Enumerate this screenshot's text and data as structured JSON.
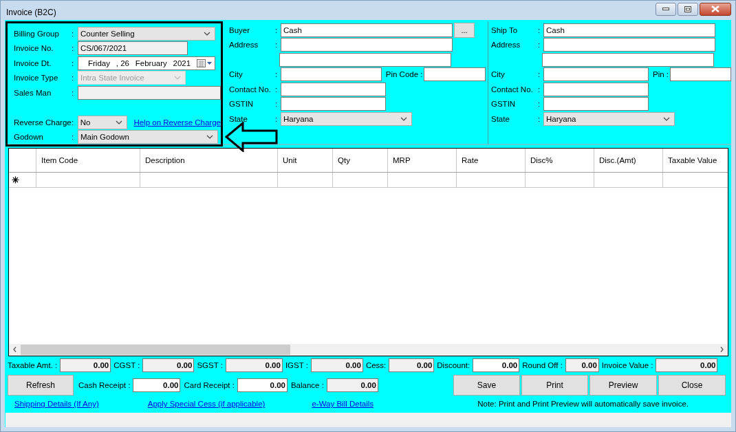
{
  "window": {
    "title": "Invoice (B2C)"
  },
  "invoice_panel": {
    "rows": [
      {
        "kind": "dropdown",
        "label": "Billing Group",
        "colon": ":",
        "value": "Counter Selling",
        "disabled": false
      },
      {
        "kind": "readonly",
        "label": "Invoice No.",
        "colon": ":",
        "value": "CS/067/2021"
      },
      {
        "kind": "date",
        "label": "Invoice Dt.",
        "colon": ":",
        "parts": [
          "Friday",
          ", 26",
          "February",
          "2021"
        ]
      },
      {
        "kind": "dropdown",
        "label": "Invoice Type",
        "colon": ":",
        "value": "Intra State Invoice",
        "disabled": true
      },
      {
        "kind": "readonly",
        "label": "Sales Man",
        "colon": ":"
      }
    ],
    "lower_rows": [
      {
        "kind": "dropdown",
        "label": "Reverse Charge",
        "colon": ":",
        "value": "No",
        "disabled": false,
        "link": "Help on Reverse Charge"
      },
      {
        "kind": "dropdown",
        "label": "Godown",
        "colon": ":",
        "value": "Main Godown",
        "disabled": false
      }
    ]
  },
  "buyer": {
    "rows": [
      {
        "kind": "text",
        "label": "Buyer",
        "colon": ":",
        "value": "Cash",
        "button": "..."
      },
      {
        "kind": "address",
        "label": "Address",
        "colon": ":"
      },
      {
        "kind": "pair",
        "label": "City",
        "colon": ":",
        "second_label": "Pin Code :"
      },
      {
        "kind": "text",
        "label": "Contact No.",
        "colon": ":"
      },
      {
        "kind": "text",
        "label": "GSTIN",
        "colon": ":"
      },
      {
        "kind": "dropdown",
        "label": "State",
        "colon": ":",
        "value": "Haryana",
        "disabled": false
      }
    ]
  },
  "ship_to": {
    "rows": [
      {
        "kind": "text",
        "label": "Ship To",
        "colon": ":",
        "value": "Cash"
      },
      {
        "kind": "address",
        "label": "Address",
        "colon": ":"
      },
      {
        "kind": "pair",
        "label": "City",
        "colon": ":",
        "second_label": "Pin :"
      },
      {
        "kind": "text",
        "label": "Contact No.",
        "colon": ":"
      },
      {
        "kind": "text",
        "label": "GSTIN",
        "colon": ":"
      },
      {
        "kind": "dropdown",
        "label": "State",
        "colon": ":",
        "value": "Haryana",
        "disabled": false
      }
    ]
  },
  "table": {
    "columns": [
      "Item Code",
      "Description",
      "Unit",
      "Qty",
      "MRP",
      "Rate",
      "Disc%",
      "Disc.(Amt)",
      "Taxable Value"
    ]
  },
  "totals": [
    {
      "label": "Taxable Amt. :",
      "value": "0.00",
      "editable": false
    },
    {
      "label": "CGST :",
      "value": "0.00",
      "editable": false
    },
    {
      "label": "SGST :",
      "value": "0.00",
      "editable": false
    },
    {
      "label": "IGST :",
      "value": "0.00",
      "editable": false
    },
    {
      "label": "Cess:",
      "value": "0.00",
      "editable": false
    },
    {
      "label": "Discount:",
      "value": "0.00",
      "editable": true
    },
    {
      "label": "Round Off :",
      "value": "0.00",
      "editable": false
    },
    {
      "label": "Invoice Value :",
      "value": "0.00",
      "editable": false
    }
  ],
  "refresh_button": "Refresh",
  "receipts": [
    {
      "label": "Cash Receipt :",
      "value": "0.00",
      "editable": true
    },
    {
      "label": "Card Receipt :",
      "value": "0.00",
      "editable": true
    },
    {
      "label": "Balance :",
      "value": "0.00",
      "editable": false
    }
  ],
  "buttons": [
    "Save",
    "Print",
    "Preview",
    "Close"
  ],
  "links": [
    "Shipping Details (If Any)",
    "Apply Special Cess (if applicable)",
    "e-Way Bill Details"
  ],
  "note": "Note: Print and Print Preview will automatically save invoice."
}
